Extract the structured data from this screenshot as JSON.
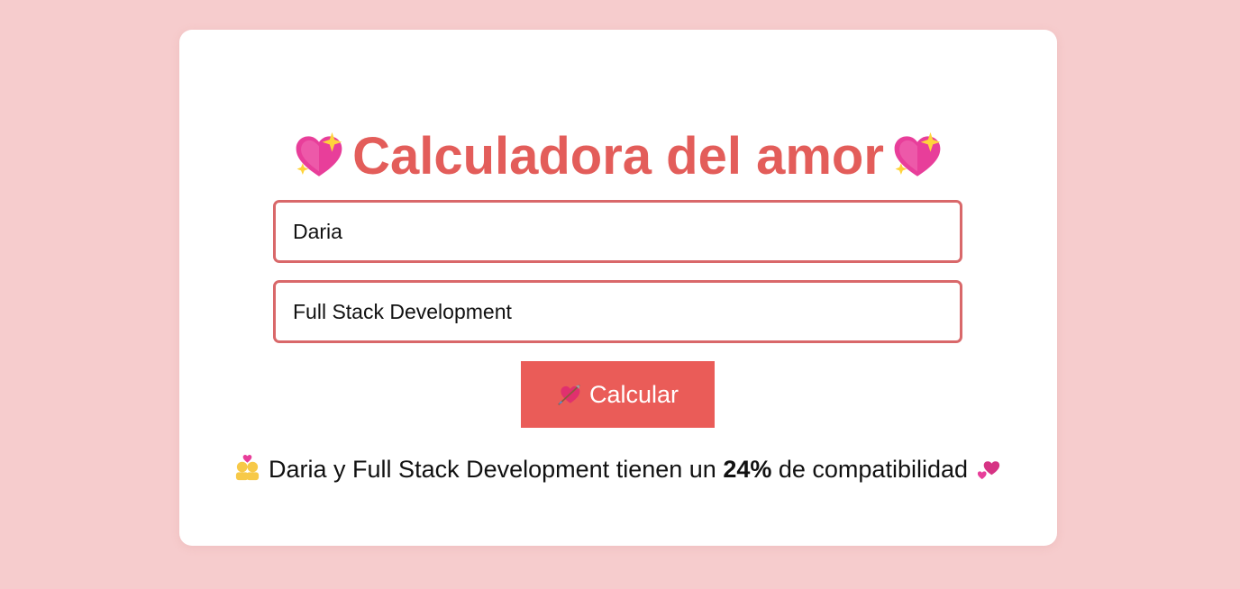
{
  "app": {
    "title": "Calculadora del amor",
    "title_emoji": "sparkling-heart-icon"
  },
  "form": {
    "name1_value": "Daria",
    "name2_value": "Full Stack Development",
    "submit_label": "Calcular",
    "submit_emoji": "heart-with-arrow-icon"
  },
  "result": {
    "name1": "Daria",
    "connector": "y",
    "name2": "Full Stack Development",
    "text_before": "tienen un",
    "percentage": "24%",
    "text_after": "de compatibilidad",
    "leading_emoji": "couple-with-heart-icon",
    "trailing_emoji": "revolving-hearts-icon"
  },
  "colors": {
    "background": "#f6cccd",
    "card": "#ffffff",
    "accent": "#e35d5a",
    "button": "#ea5c58",
    "input_border": "#d9686a"
  }
}
